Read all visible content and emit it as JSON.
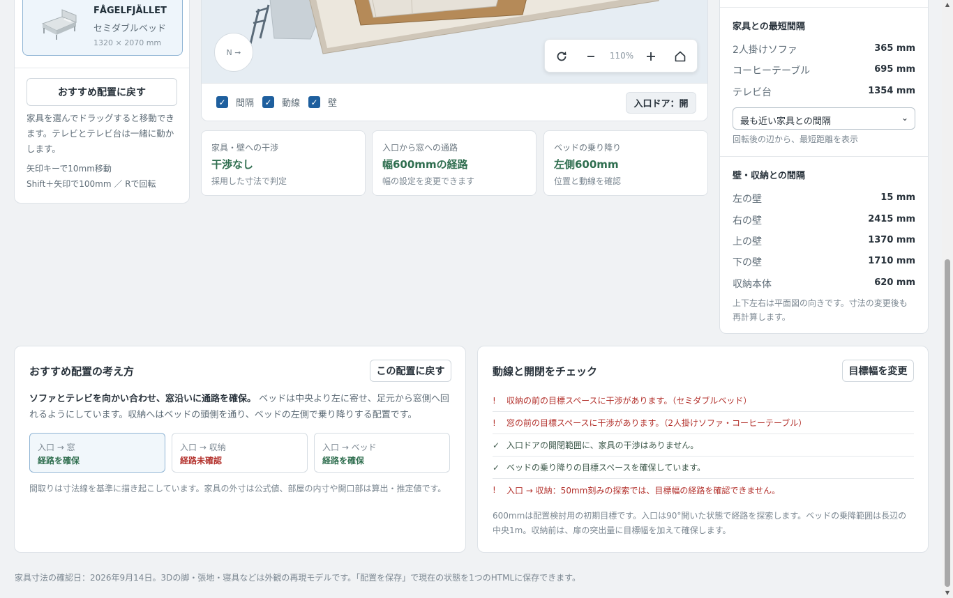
{
  "furniture_item": {
    "name": "FÅGELFJÄLLET",
    "type": "セミダブルベッド",
    "dims": "1320 × 2070 mm"
  },
  "left_panel": {
    "reset_label": "おすすめ配置に戻す",
    "help": "家具を選んでドラッグすると移動できます。テレビとテレビ台は一緒に動かします。",
    "key_hint_1": "矢印キーで10mm移動",
    "key_hint_2": "Shift＋矢印で100mm ／ Rで回転"
  },
  "plan": {
    "compass": "N ➞",
    "zoom_level": "110%",
    "icons": [
      "rotate-icon",
      "zoom-out-icon",
      "zoom-in-icon",
      "home-icon"
    ],
    "toggles": [
      {
        "label": "間隔",
        "checked": true
      },
      {
        "label": "動線",
        "checked": true
      },
      {
        "label": "壁",
        "checked": true
      }
    ],
    "door_label": "入口ドア：開"
  },
  "status_cards": [
    {
      "label": "家具・壁への干渉",
      "value": "干渉なし",
      "note": "採用した寸法で判定"
    },
    {
      "label": "入口から窓への通路",
      "value": "幅600mmの経路",
      "note": "幅の設定を変更できます"
    },
    {
      "label": "ベッドの乗り降り",
      "value": "左側600mm",
      "note": "位置と動線を確認"
    }
  ],
  "nearest": {
    "title": "家具との最短間隔",
    "rows": [
      {
        "label": "2人掛けソファ",
        "value": "365 mm"
      },
      {
        "label": "コーヒーテーブル",
        "value": "695 mm"
      },
      {
        "label": "テレビ台",
        "value": "1354 mm"
      }
    ],
    "select_value": "最も近い家具との間隔",
    "note": "回転後の辺から、最短距離を表示"
  },
  "walls": {
    "title": "壁・収納との間隔",
    "rows": [
      {
        "label": "左の壁",
        "value": "15 mm"
      },
      {
        "label": "右の壁",
        "value": "2415 mm"
      },
      {
        "label": "上の壁",
        "value": "1370 mm"
      },
      {
        "label": "下の壁",
        "value": "1710 mm"
      },
      {
        "label": "収納本体",
        "value": "620 mm"
      }
    ],
    "note": "上下左右は平面図の向きです。寸法の変更後も再計算します。"
  },
  "recommend": {
    "title": "おすすめ配置の考え方",
    "reset_label": "この配置に戻す",
    "lead": "ソファとテレビを向かい合わせ、窓沿いに通路を確保。",
    "body": "ベッドは中央より左に寄せ、足元から窓側へ回れるようにしています。収納へはベッドの頭側を通り、ベッドの左側で乗り降りする配置です。",
    "routes": [
      {
        "label": "入口 → 窓",
        "status": "経路を確保",
        "ok": true
      },
      {
        "label": "入口 → 収納",
        "status": "経路未確認",
        "ok": false
      },
      {
        "label": "入口 → ベッド",
        "status": "経路を確保",
        "ok": true
      }
    ],
    "note": "間取りは寸法線を基準に描き起こしています。家具の外寸は公式値、部屋の内寸や開口部は算出・推定値です。"
  },
  "checks": {
    "title": "動線と開閉をチェック",
    "change_label": "目標幅を変更",
    "items": [
      {
        "mark": "!",
        "text": "収納の前の目標スペースに干渉があります。（セミダブルベッド）",
        "level": "warn"
      },
      {
        "mark": "!",
        "text": "窓の前の目標スペースに干渉があります。（2人掛けソファ・コーヒーテーブル）",
        "level": "warn"
      },
      {
        "mark": "✓",
        "text": "入口ドアの開閉範囲に、家具の干渉はありません。",
        "level": "good"
      },
      {
        "mark": "✓",
        "text": "ベッドの乗り降りの目標スペースを確保しています。",
        "level": "good"
      },
      {
        "mark": "!",
        "text": "入口 → 収納：50mm刻みの探索では、目標幅の経路を確認できません。",
        "level": "warn"
      }
    ],
    "note": "600mmは配置検討用の初期目標です。入口は90°開いた状態で経路を探索します。ベッドの乗降範囲は長辺の中央1m。収納前は、扉の突出量に目標幅を加えて確保します。"
  },
  "footer": "家具寸法の確認日：2026年9月14日。3Dの脚・張地・寝具などは外観の再現モデルです。「配置を保存」で現在の状態を1つのHTMLに保存できます。",
  "colors": {
    "accent": "#1e5f9e",
    "ok": "#2f6e4f",
    "warn": "#b3312c"
  }
}
